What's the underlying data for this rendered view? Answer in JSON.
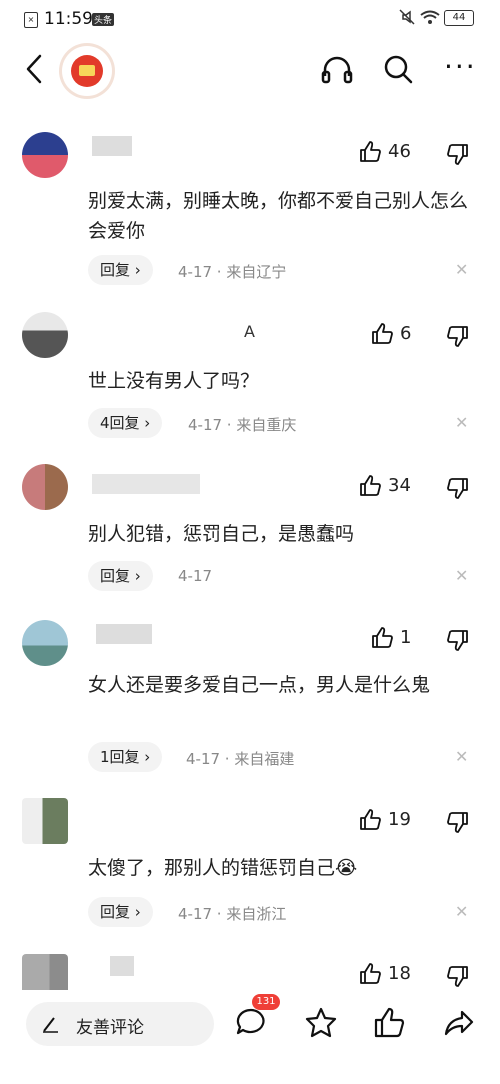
{
  "status_bar": {
    "time": "11:59",
    "battery": "44",
    "hd": "头条"
  },
  "header": {
    "logo": "red-envelope-logo"
  },
  "comments": [
    {
      "username": "",
      "likes": "46",
      "text": "别爱太满，别睡太晚，你都不爱自己别人怎么会爱你",
      "reply": "回复 ›",
      "meta": "4-17 · 来自辽宁"
    },
    {
      "username": "A",
      "likes": "6",
      "text": "世上没有男人了吗？",
      "reply": "4回复 ›",
      "meta": "4-17 · 来自重庆"
    },
    {
      "username": "",
      "likes": "34",
      "text": "别人犯错，惩罚自己，是愚蠢吗",
      "reply": "回复 ›",
      "meta": "4-17"
    },
    {
      "username": "",
      "likes": "1",
      "text": "女人还是要多爱自己一点，男人是什么鬼",
      "reply": "1回复 ›",
      "meta": "4-17 · 来自福建"
    },
    {
      "username": "",
      "likes": "19",
      "text": "太傻了，那别人的错惩罚自己😭",
      "reply": "回复 ›",
      "meta": "4-17 · 来自浙江"
    },
    {
      "username": "",
      "likes": "18"
    }
  ],
  "bottom": {
    "placeholder": "友善评论",
    "comment_count": "131"
  }
}
